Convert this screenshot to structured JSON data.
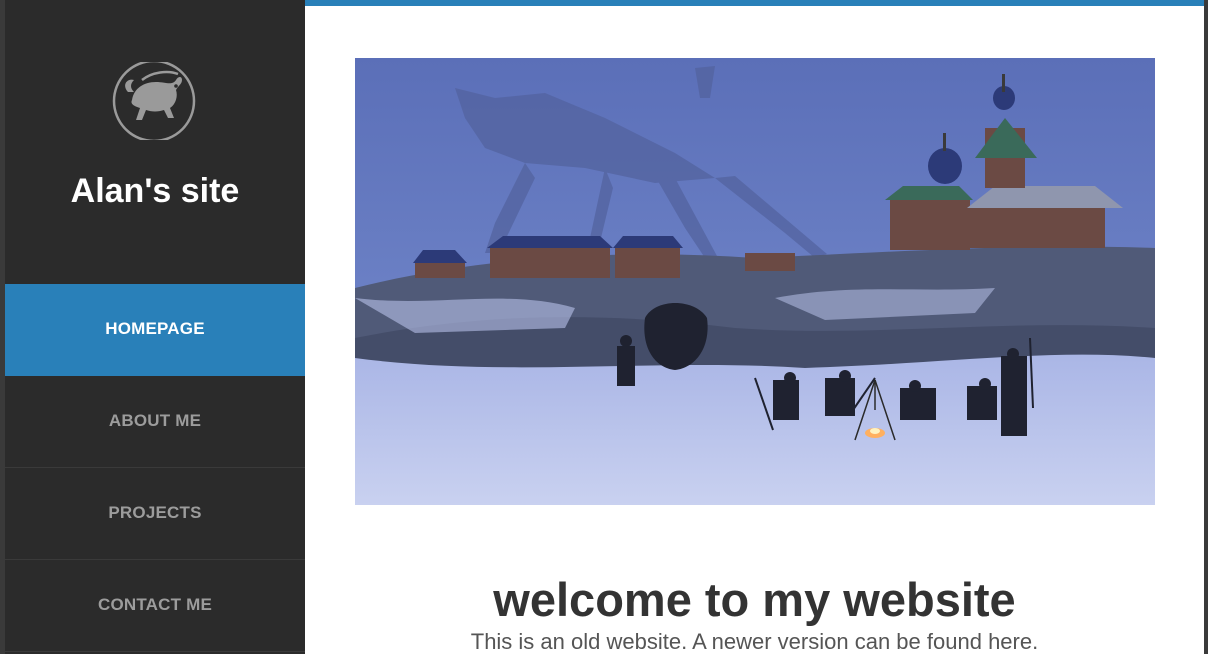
{
  "site": {
    "title": "Alan's site"
  },
  "nav": {
    "items": [
      {
        "label": "HOMEPAGE",
        "active": true
      },
      {
        "label": "ABOUT ME",
        "active": false
      },
      {
        "label": "PROJECTS",
        "active": false
      },
      {
        "label": "CONTACT ME",
        "active": false
      }
    ]
  },
  "main": {
    "headline": "welcome to my website",
    "subline_prefix": "This is an old website. A newer version can be found ",
    "subline_link": "here",
    "subline_suffix": "."
  },
  "colors": {
    "accent": "#2980b9",
    "sidebar": "#2b2b2b",
    "main_bg": "#ffffff"
  },
  "icons": {
    "logo": "dragon-emblem-icon"
  }
}
